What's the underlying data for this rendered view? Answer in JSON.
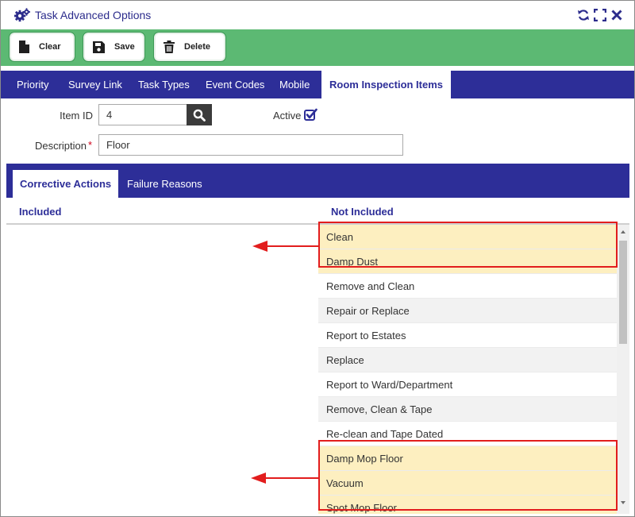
{
  "window": {
    "title": "Task Advanced Options"
  },
  "title_actions": [
    {
      "name": "refresh-icon"
    },
    {
      "name": "expand-icon"
    },
    {
      "name": "close-icon"
    }
  ],
  "toolbar": {
    "clear_label": "Clear",
    "save_label": "Save",
    "delete_label": "Delete"
  },
  "tabs": [
    {
      "label": "Priority"
    },
    {
      "label": "Survey Link"
    },
    {
      "label": "Task Types"
    },
    {
      "label": "Event Codes"
    },
    {
      "label": "Mobile"
    },
    {
      "label": "Room Inspection Items"
    }
  ],
  "active_tab": "Room Inspection Items",
  "form": {
    "item_id_label": "Item ID",
    "item_id_value": "4",
    "active_label": "Active",
    "active_checked": true,
    "description_label": "Description",
    "required_marker": "*",
    "description_value": "Floor"
  },
  "subtabs": [
    {
      "label": "Corrective Actions"
    },
    {
      "label": "Failure Reasons"
    }
  ],
  "active_subtab": "Corrective Actions",
  "columns": {
    "included_header": "Included",
    "not_included_header": "Not Included"
  },
  "included_items": [],
  "not_included_items": [
    {
      "label": "Clean",
      "highlighted": true
    },
    {
      "label": "Damp Dust",
      "highlighted": true
    },
    {
      "label": "Remove and Clean",
      "highlighted": false
    },
    {
      "label": "Repair or Replace",
      "highlighted": false
    },
    {
      "label": "Report to Estates",
      "highlighted": false
    },
    {
      "label": "Replace",
      "highlighted": false
    },
    {
      "label": "Report to Ward/Department",
      "highlighted": false
    },
    {
      "label": "Remove, Clean & Tape",
      "highlighted": false
    },
    {
      "label": "Re-clean and Tape Dated",
      "highlighted": false
    },
    {
      "label": "Damp Mop Floor",
      "highlighted": true
    },
    {
      "label": "Vacuum",
      "highlighted": true
    },
    {
      "label": "Spot Mop Floor",
      "highlighted": true
    }
  ],
  "colors": {
    "title_text": "#2c2c8c",
    "toolbar_bg": "#5cb973",
    "tab_bar_bg": "#2d2e98",
    "highlight_row": "#fdefc0",
    "annotation_red": "#e21d1d"
  }
}
